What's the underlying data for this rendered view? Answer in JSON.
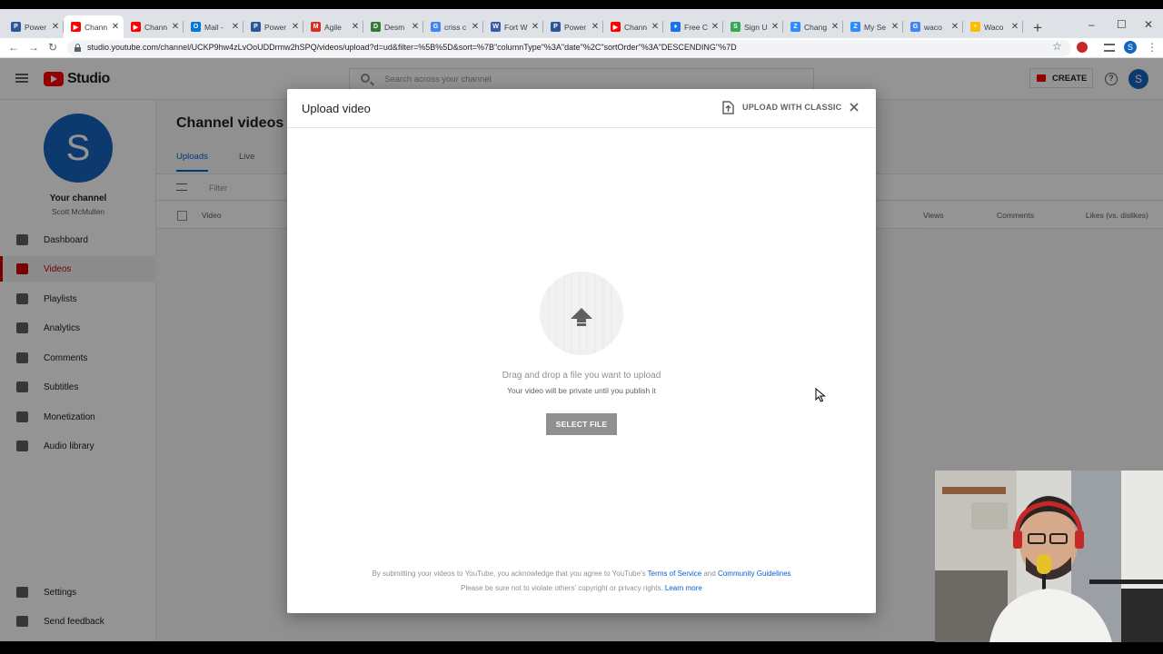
{
  "browser": {
    "tabs": [
      {
        "label": "Power",
        "color": "#2b579a",
        "glyph": "P",
        "active": false
      },
      {
        "label": "Chann",
        "color": "#ff0000",
        "glyph": "▶",
        "active": true
      },
      {
        "label": "Chann",
        "color": "#ff0000",
        "glyph": "▶",
        "active": false
      },
      {
        "label": "Mail -",
        "color": "#0078d4",
        "glyph": "O",
        "active": false
      },
      {
        "label": "Power",
        "color": "#2b579a",
        "glyph": "P",
        "active": false
      },
      {
        "label": "Agile",
        "color": "#d93025",
        "glyph": "M",
        "active": false
      },
      {
        "label": "Desm",
        "color": "#2e7d32",
        "glyph": "D",
        "active": false
      },
      {
        "label": "criss c",
        "color": "#4285f4",
        "glyph": "G",
        "active": false
      },
      {
        "label": "Fort W",
        "color": "#3b5ba5",
        "glyph": "W",
        "active": false
      },
      {
        "label": "Power",
        "color": "#2b579a",
        "glyph": "P",
        "active": false
      },
      {
        "label": "Chann",
        "color": "#ff0000",
        "glyph": "▶",
        "active": false
      },
      {
        "label": "Free C",
        "color": "#1a73e8",
        "glyph": "♦",
        "active": false
      },
      {
        "label": "Sign U",
        "color": "#34a853",
        "glyph": "S",
        "active": false
      },
      {
        "label": "Chang",
        "color": "#2d8cff",
        "glyph": "Z",
        "active": false
      },
      {
        "label": "My Se",
        "color": "#2d8cff",
        "glyph": "Z",
        "active": false
      },
      {
        "label": "waco",
        "color": "#4285f4",
        "glyph": "G",
        "active": false
      },
      {
        "label": "Waco",
        "color": "#fbbc04",
        "glyph": "•",
        "active": false
      }
    ],
    "url": "studio.youtube.com/channel/UCKP9hw4zLvOoUDDrmw2hSPQ/videos/upload?d=ud&filter=%5B%5D&sort=%7B\"columnType\"%3A\"date\"%2C\"sortOrder\"%3A\"DESCENDING\"%7D",
    "profile_initial": "S"
  },
  "studio": {
    "logo_text": "Studio",
    "search_placeholder": "Search across your channel",
    "create_label": "CREATE",
    "avatar_initial": "S",
    "channel_label": "Your channel",
    "channel_owner": "Scott McMullen",
    "nav": [
      {
        "label": "Dashboard",
        "icon": "dashboard-icon",
        "active": false
      },
      {
        "label": "Videos",
        "icon": "videos-icon",
        "active": true
      },
      {
        "label": "Playlists",
        "icon": "playlists-icon",
        "active": false
      },
      {
        "label": "Analytics",
        "icon": "analytics-icon",
        "active": false
      },
      {
        "label": "Comments",
        "icon": "comments-icon",
        "active": false
      },
      {
        "label": "Subtitles",
        "icon": "subtitles-icon",
        "active": false
      },
      {
        "label": "Monetization",
        "icon": "dollar-icon",
        "active": false
      },
      {
        "label": "Audio library",
        "icon": "audio-library-icon",
        "active": false
      }
    ],
    "nav_bottom": [
      {
        "label": "Settings",
        "icon": "gear-icon"
      },
      {
        "label": "Send feedback",
        "icon": "feedback-icon"
      }
    ],
    "page_title": "Channel videos",
    "tabs": {
      "uploads": "Uploads",
      "live": "Live"
    },
    "filter_placeholder": "Filter",
    "columns": {
      "video": "Video",
      "views": "Views",
      "comments": "Comments",
      "likes": "Likes (vs. dislikes)"
    }
  },
  "dialog": {
    "title": "Upload video",
    "classic_label": "UPLOAD WITH CLASSIC",
    "drag_text": "Drag and drop a file you want to upload",
    "private_text": "Your video will be private until you publish it",
    "select_label": "SELECT FILE",
    "legal": {
      "line1_prefix": "By submitting your videos to YouTube, you acknowledge that you agree to YouTube's ",
      "terms": "Terms of Service",
      "and": " and ",
      "guidelines": "Community Guidelines",
      "line2_prefix": "Please be sure not to violate others' copyright or privacy rights. ",
      "learn_more": "Learn more"
    }
  },
  "colors": {
    "youtube_red": "#ff0000",
    "link_blue": "#065fd4",
    "avatar_blue": "#1565c0",
    "select_button_gray": "#909090"
  }
}
